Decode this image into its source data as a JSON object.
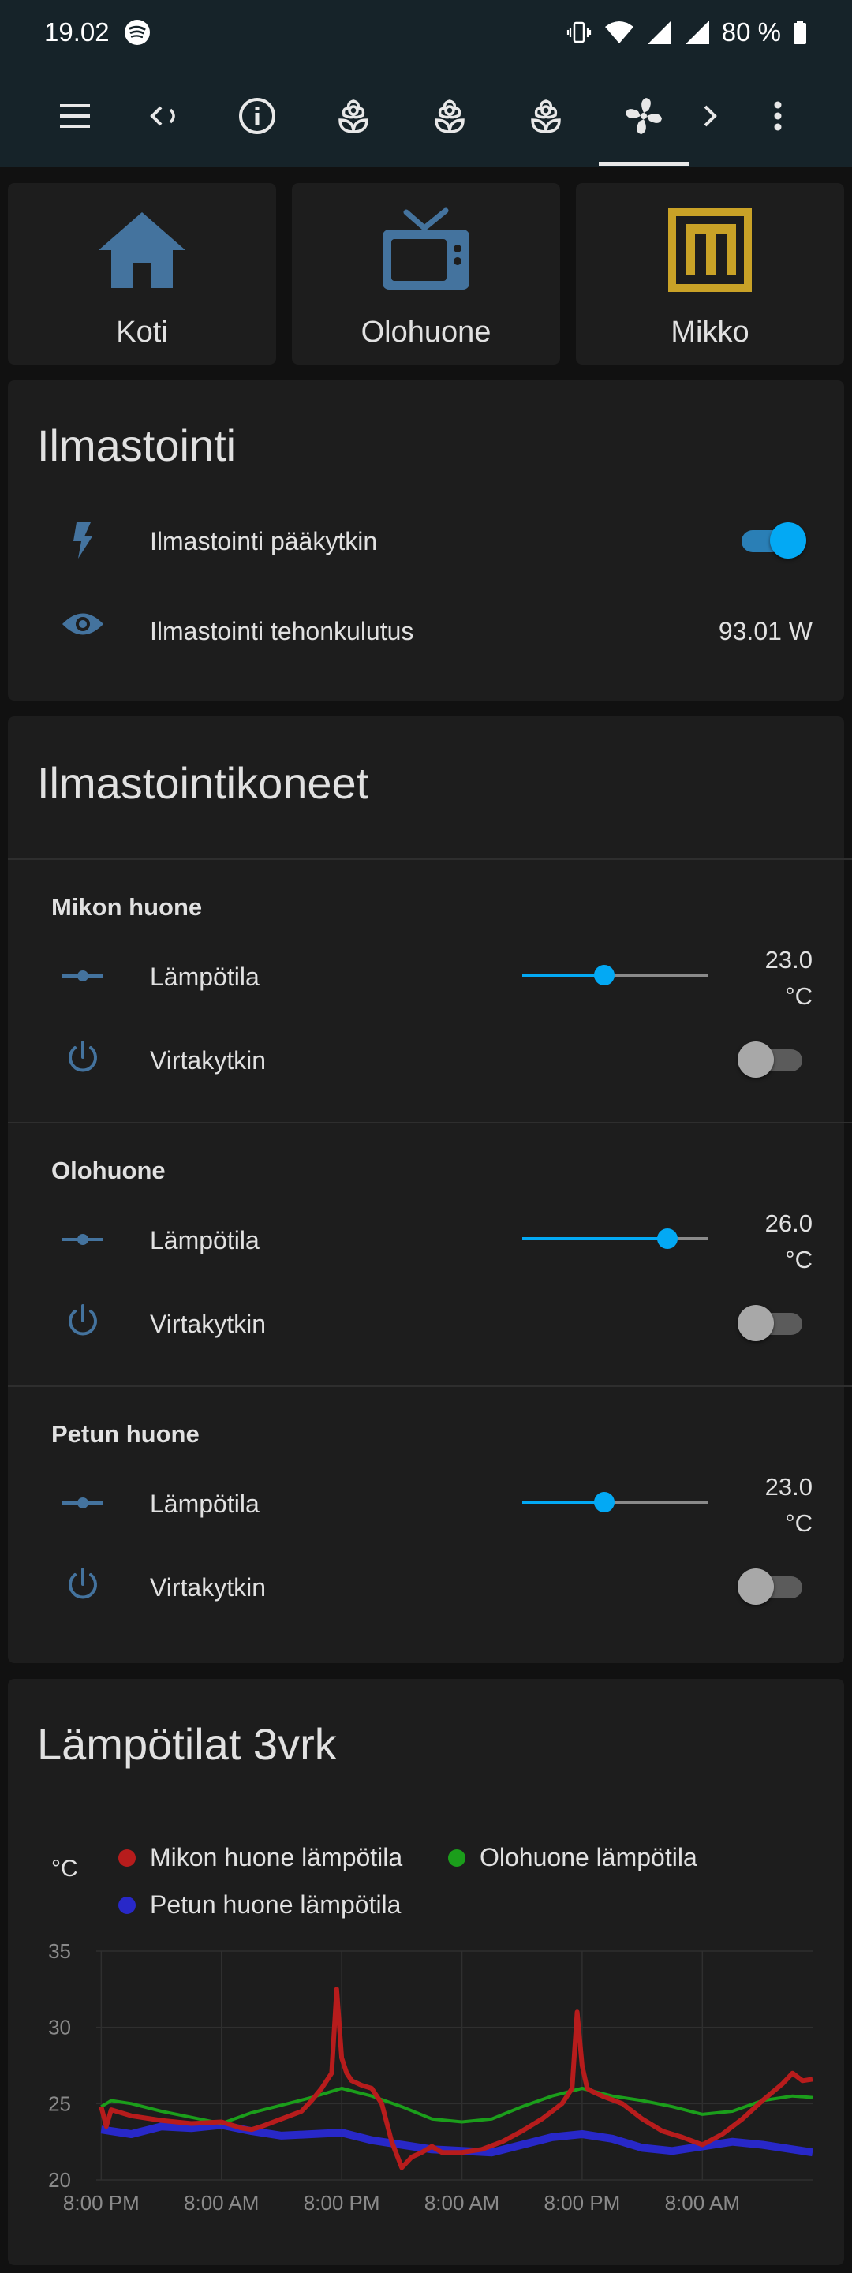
{
  "status_bar": {
    "time": "19.02",
    "battery": "80 %",
    "icons": [
      "spotify-icon",
      "vibrate-icon",
      "wifi-icon",
      "signal-icon",
      "battery-icon"
    ]
  },
  "toolbar": {
    "icons": [
      "menu-icon",
      "back-icon",
      "info-icon",
      "flower-icon",
      "flower-icon",
      "flower-icon",
      "fan-icon",
      "chevron-right-icon",
      "more-vert-icon"
    ]
  },
  "nav": [
    {
      "label": "Koti",
      "icon": "home-icon"
    },
    {
      "label": "Olohuone",
      "icon": "tv-icon"
    },
    {
      "label": "Mikko",
      "icon": "mikko-logo"
    }
  ],
  "ilmastointi": {
    "title": "Ilmastointi",
    "main_switch": {
      "label": "Ilmastointi pääkytkin",
      "icon": "flash-icon",
      "state": "on"
    },
    "power": {
      "label": "Ilmastointi tehonkulutus",
      "value": "93.01 W",
      "icon": "eye-icon"
    }
  },
  "koneet": {
    "title": "Ilmastointikoneet",
    "rooms": [
      {
        "name": "Mikon huone",
        "temp_label": "Lämpötila",
        "temp_value": "23.0",
        "temp_unit": "°C",
        "slider_fraction": 0.44,
        "switch_label": "Virtakytkin",
        "switch_state": "off"
      },
      {
        "name": "Olohuone",
        "temp_label": "Lämpötila",
        "temp_value": "26.0",
        "temp_unit": "°C",
        "slider_fraction": 0.78,
        "switch_label": "Virtakytkin",
        "switch_state": "off"
      },
      {
        "name": "Petun huone",
        "temp_label": "Lämpötila",
        "temp_value": "23.0",
        "temp_unit": "°C",
        "slider_fraction": 0.44,
        "switch_label": "Virtakytkin",
        "switch_state": "off"
      }
    ]
  },
  "history": {
    "title": "Lämpötilat 3vrk"
  },
  "colors": {
    "accent": "#03a9f4",
    "icon_blue": "#44739e",
    "mikko_gold": "#c9a227",
    "card_bg": "#1d1d1d",
    "header_bg": "#162329"
  },
  "chart_data": {
    "type": "line",
    "title": "",
    "ylabel": "°C",
    "xlabel": "",
    "ylim": [
      20,
      35
    ],
    "yticks": [
      "35",
      "30",
      "25",
      "20"
    ],
    "xticks": [
      "8:00 PM",
      "8:00 AM",
      "8:00 PM",
      "8:00 AM",
      "8:00 PM",
      "8:00 AM"
    ],
    "x_hours": [
      0,
      12,
      24,
      36,
      48,
      60
    ],
    "x_range": [
      -0.5,
      71
    ],
    "grid": true,
    "legend_placement": "top",
    "series": [
      {
        "name": "Mikon huone lämpötila",
        "color": "#b71c1c",
        "x": [
          0,
          0.5,
          1,
          3,
          6,
          9,
          12,
          14,
          15,
          16,
          18,
          20,
          21,
          22,
          23,
          23.5,
          24,
          24.5,
          25,
          26,
          27,
          28,
          29,
          30,
          31,
          32,
          33,
          34,
          36,
          38,
          40,
          42,
          44,
          46,
          47,
          47.5,
          48,
          48.5,
          49,
          50,
          52,
          54,
          56,
          58,
          60,
          62,
          64,
          66,
          68,
          69,
          70,
          71
        ],
        "values": [
          24.8,
          23.5,
          24.6,
          24.2,
          23.9,
          23.7,
          23.8,
          23.4,
          23.3,
          23.5,
          24.0,
          24.5,
          25.2,
          26.0,
          27.0,
          32.5,
          28.0,
          27.0,
          26.5,
          26.2,
          26.0,
          25.0,
          22.5,
          20.8,
          21.5,
          21.8,
          22.2,
          21.8,
          21.8,
          22.0,
          22.5,
          23.2,
          24.0,
          25.0,
          26.0,
          31.0,
          27.5,
          26.0,
          25.8,
          25.5,
          25.0,
          24.0,
          23.2,
          22.8,
          22.3,
          23.0,
          24.0,
          25.2,
          26.3,
          27.0,
          26.5,
          26.6
        ]
      },
      {
        "name": "Olohuone lämpötila",
        "color": "#1b9e1b",
        "x": [
          0,
          1,
          3,
          6,
          9,
          12,
          15,
          18,
          21,
          24,
          27,
          30,
          33,
          36,
          39,
          42,
          45,
          48,
          51,
          54,
          57,
          60,
          63,
          66,
          69,
          71
        ],
        "values": [
          24.8,
          25.2,
          25.0,
          24.5,
          24.1,
          23.7,
          24.4,
          24.9,
          25.4,
          26.0,
          25.5,
          24.8,
          24.0,
          23.8,
          24.0,
          24.8,
          25.5,
          26.0,
          25.5,
          25.2,
          24.8,
          24.3,
          24.5,
          25.2,
          25.5,
          25.4
        ]
      },
      {
        "name": "Petun huone lämpötila",
        "color": "#2828c8",
        "x": [
          0,
          3,
          6,
          9,
          12,
          15,
          18,
          21,
          24,
          27,
          30,
          33,
          36,
          39,
          42,
          45,
          48,
          51,
          54,
          57,
          60,
          63,
          66,
          69,
          71
        ],
        "values": [
          23.3,
          23.0,
          23.5,
          23.4,
          23.6,
          23.2,
          22.9,
          23.0,
          23.1,
          22.6,
          22.3,
          22.0,
          21.9,
          21.8,
          22.3,
          22.8,
          23.0,
          22.7,
          22.1,
          21.9,
          22.2,
          22.5,
          22.3,
          22.0,
          21.8
        ]
      }
    ]
  }
}
